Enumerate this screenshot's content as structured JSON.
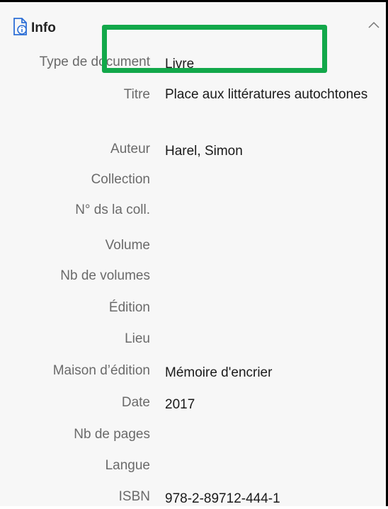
{
  "header": {
    "title": "Info",
    "icon": "document-info-icon",
    "collapse_icon": "chevron-up-icon"
  },
  "fields": [
    {
      "label": "Type de document",
      "value": "Livre"
    },
    {
      "label": "Titre",
      "value": "Place aux littératures autochtones"
    },
    {
      "label": "Auteur",
      "value": "Harel, Simon"
    },
    {
      "label": "Collection",
      "value": ""
    },
    {
      "label": "N° ds la coll.",
      "value": ""
    },
    {
      "label": "Volume",
      "value": ""
    },
    {
      "label": "Nb de volumes",
      "value": ""
    },
    {
      "label": "Édition",
      "value": ""
    },
    {
      "label": "Lieu",
      "value": ""
    },
    {
      "label": "Maison d’édition",
      "value": "Mémoire d'encrier"
    },
    {
      "label": "Date",
      "value": "2017"
    },
    {
      "label": "Nb de pages",
      "value": ""
    },
    {
      "label": "Langue",
      "value": ""
    },
    {
      "label": "ISBN",
      "value": "978-2-89712-444-1"
    }
  ],
  "colors": {
    "highlight": "#12a84a",
    "icon_accent": "#2d6fd6"
  }
}
